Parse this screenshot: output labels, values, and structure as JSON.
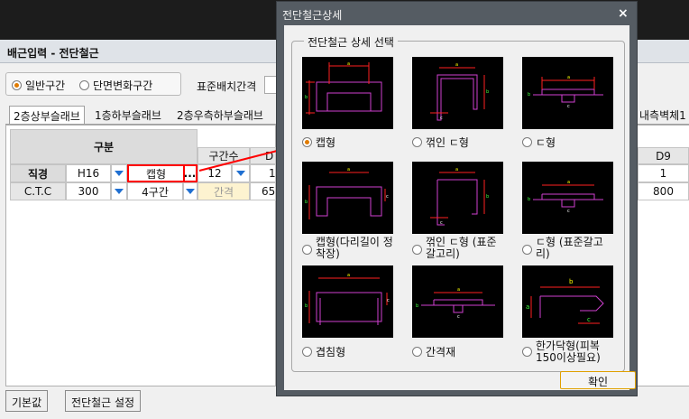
{
  "window": {
    "title": "배근입력 - 전단철근"
  },
  "mode_radio": {
    "options": [
      {
        "label": "일반구간",
        "selected": true
      },
      {
        "label": "단면변화구간",
        "selected": false
      }
    ]
  },
  "spacing_label": "표준배치간격",
  "tabs": [
    {
      "label": "2층상부슬래브",
      "active": true
    },
    {
      "label": "1층하부슬래브",
      "active": false
    },
    {
      "label": "2층우측하부슬래브",
      "active": false
    }
  ],
  "right_tab_label": "내측벽체1",
  "grid": {
    "header_group": "구분",
    "header_sections": "구간수",
    "header_d_partial": "D",
    "rows": [
      {
        "label": "직경",
        "value": "H16",
        "shape": "캡형",
        "shape_button": "...",
        "sections": "12",
        "d_partial": "1"
      },
      {
        "label": "C.T.C",
        "value": "300",
        "shape": "4구간",
        "sections": "간격",
        "d_partial": "65"
      }
    ]
  },
  "right_grid": {
    "header": "D9",
    "values": [
      "1",
      "800"
    ]
  },
  "bottom_buttons": {
    "default": "기본값",
    "settings": "전단철근 설정"
  },
  "dialog": {
    "title": "전단철근상세",
    "close": "×",
    "group_label": "전단철근 상세 선택",
    "options": [
      {
        "label": "캡형",
        "selected": true,
        "icon": "cap-shape-diagram",
        "dims": [
          "a",
          "b"
        ]
      },
      {
        "label": "꺾인 ㄷ형",
        "selected": false,
        "icon": "bent-c-shape-diagram",
        "dims": [
          "a",
          "b",
          "c"
        ]
      },
      {
        "label": "ㄷ형",
        "selected": false,
        "icon": "c-shape-diagram",
        "dims": [
          "a",
          "b",
          "c"
        ]
      },
      {
        "label": "캡형(다리길이 정착장)",
        "selected": false,
        "icon": "cap-anchor-shape-diagram",
        "dims": [
          "a",
          "b",
          "c"
        ]
      },
      {
        "label": "꺾인 ㄷ형 (표준갈고리)",
        "selected": false,
        "icon": "bent-c-hook-shape-diagram",
        "dims": [
          "a",
          "b",
          "c"
        ]
      },
      {
        "label": "ㄷ형 (표준갈고리)",
        "selected": false,
        "icon": "c-hook-shape-diagram",
        "dims": [
          "a",
          "b",
          "c"
        ]
      },
      {
        "label": "겹침형",
        "selected": false,
        "icon": "overlap-shape-diagram",
        "dims": [
          "a",
          "b",
          "c"
        ]
      },
      {
        "label": "간격재",
        "selected": false,
        "icon": "spacer-shape-diagram",
        "dims": [
          "a",
          "b",
          "c"
        ]
      },
      {
        "label": "한가닥형(피복 150이상필요)",
        "selected": false,
        "icon": "single-bar-shape-diagram",
        "dims": [
          "a",
          "b",
          "c"
        ]
      }
    ],
    "ok": "확인"
  },
  "colors": {
    "accent": "#e07b00",
    "highlight": "#ff0000",
    "bar": "#d040d0",
    "dim": "#ff2020"
  }
}
